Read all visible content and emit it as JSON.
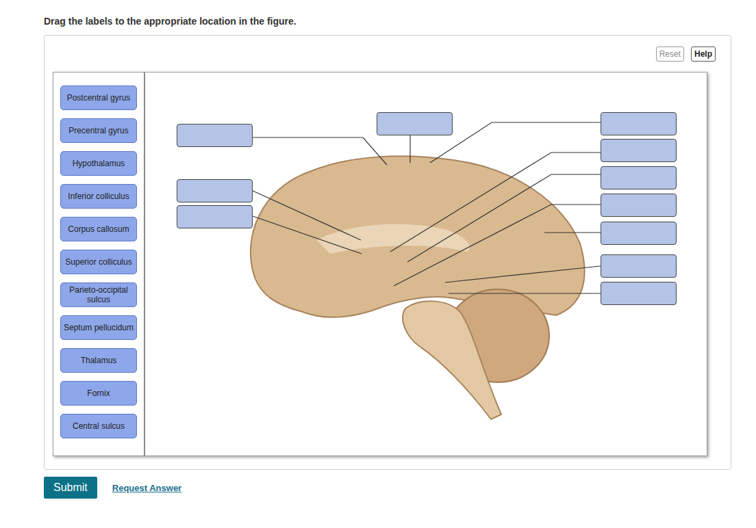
{
  "instruction": "Drag the labels to the appropriate location in the figure.",
  "toolbar": [
    "Reset",
    "Help"
  ],
  "labels": [
    "Postcentral gyrus",
    "Precentral gyrus",
    "Hypothalamus",
    "Inferior colliculus",
    "Corpus callosum",
    "Superior colliculus",
    "Parieto-occipital sulcus",
    "Septum pellucidum",
    "Thalamus",
    "Fornix",
    "Central sulcus"
  ],
  "targets": [
    {
      "value": ""
    },
    {
      "value": ""
    },
    {
      "value": ""
    },
    {
      "value": ""
    },
    {
      "value": ""
    },
    {
      "value": ""
    },
    {
      "value": ""
    },
    {
      "value": ""
    },
    {
      "value": ""
    },
    {
      "value": ""
    },
    {
      "value": ""
    }
  ],
  "footer": {
    "submit": "Submit",
    "link": "Request Answer"
  }
}
